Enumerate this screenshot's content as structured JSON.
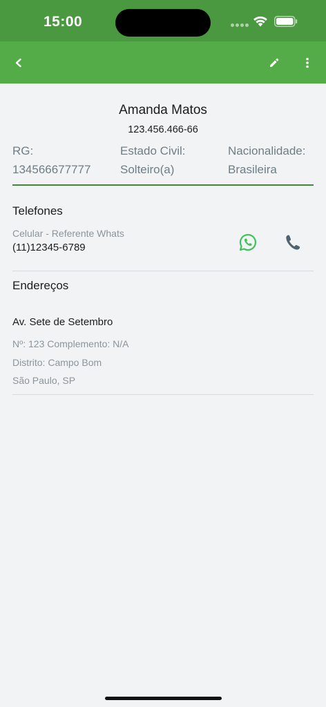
{
  "status_bar": {
    "time": "15:00"
  },
  "profile": {
    "name": "Amanda Matos",
    "document": "123.456.466-66",
    "fields": [
      {
        "label": "RG:",
        "value": "134566677777"
      },
      {
        "label": "Estado Civil:",
        "value": "Solteiro(a)"
      },
      {
        "label": "Nacionalidade:",
        "value": "Brasileira"
      }
    ]
  },
  "phones": {
    "title": "Telefones",
    "items": [
      {
        "type": "Celular - Referente Whats",
        "number": "(11)12345-6789"
      }
    ]
  },
  "addresses": {
    "title": "Endereços",
    "items": [
      {
        "street": "Av. Sete de Setembro",
        "number_complement": "Nº: 123  Complemento: N/A",
        "district": "Distrito: Campo Bom",
        "city_state": "São Paulo, SP"
      }
    ]
  },
  "colors": {
    "status_bar": "#4a9940",
    "app_bar": "#54ac48",
    "whatsapp": "#3fc25a",
    "call_icon": "#4f6370"
  },
  "icons": {
    "back": "chevron-left-icon",
    "edit": "pencil-icon",
    "more": "more-vertical-icon",
    "whatsapp": "whatsapp-icon",
    "call": "phone-icon"
  }
}
